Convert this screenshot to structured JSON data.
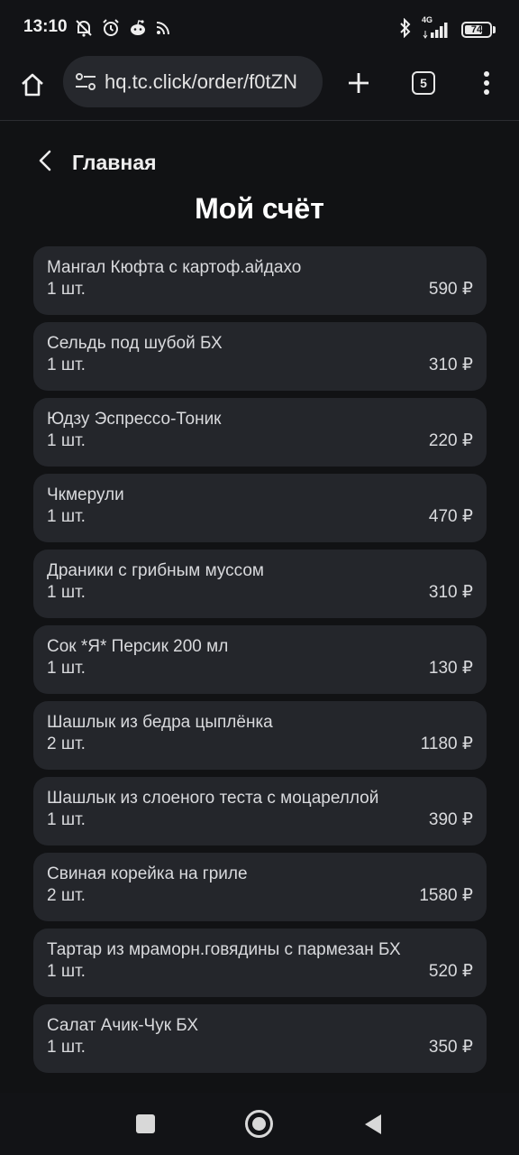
{
  "status": {
    "time": "13:10",
    "network": "4G",
    "battery": "74",
    "battery_level": 0.74
  },
  "browser": {
    "url": "hq.tc.click/order/f0tZN",
    "tab_count": "5"
  },
  "page": {
    "back_label": "Главная",
    "title": "Мой счёт"
  },
  "items": [
    {
      "name": "Мангал Кюфта с картоф.айдахо",
      "qty": "1 шт.",
      "price": "590 ₽"
    },
    {
      "name": "Сельдь под шубой БХ",
      "qty": "1 шт.",
      "price": "310 ₽"
    },
    {
      "name": "Юдзу Эспрессо-Тоник",
      "qty": "1 шт.",
      "price": "220 ₽"
    },
    {
      "name": "Чкмерули",
      "qty": "1 шт.",
      "price": "470 ₽"
    },
    {
      "name": "Драники с грибным муссом",
      "qty": "1 шт.",
      "price": "310 ₽"
    },
    {
      "name": "Сок *Я* Персик 200 мл",
      "qty": "1 шт.",
      "price": "130 ₽"
    },
    {
      "name": "Шашлык из бедра цыплёнка",
      "qty": "2 шт.",
      "price": "1180 ₽"
    },
    {
      "name": "Шашлык из слоеного теста с моцареллой",
      "qty": "1 шт.",
      "price": "390 ₽"
    },
    {
      "name": "Свиная корейка на гриле",
      "qty": "2 шт.",
      "price": "1580 ₽"
    },
    {
      "name": "Тартар из мраморн.говядины с пармезан БХ",
      "qty": "1 шт.",
      "price": "520 ₽"
    },
    {
      "name": "Салат Ачик-Чук БХ",
      "qty": "1 шт.",
      "price": "350 ₽"
    }
  ]
}
